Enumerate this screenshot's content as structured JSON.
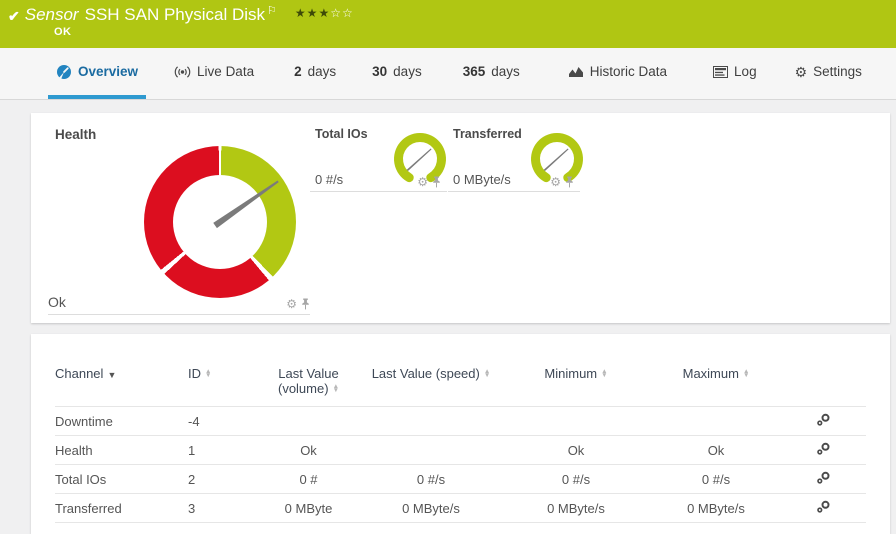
{
  "icons": {
    "check": "✔",
    "flag": "⚐",
    "stars_filled": "★★★",
    "stars_empty": "☆☆",
    "gear": "⚙",
    "sort_desc": "▼",
    "sort_up": "▲",
    "sort_down": "▼"
  },
  "header": {
    "kind": "Sensor",
    "title": "SSH SAN Physical Disk",
    "status": "OK"
  },
  "tabs": [
    {
      "label": "Overview",
      "icon": "gauge-icon",
      "active": true
    },
    {
      "label": "Live Data",
      "icon": "broadcast-icon"
    },
    {
      "num": "2",
      "label": "days"
    },
    {
      "num": "30",
      "label": "days"
    },
    {
      "num": "365",
      "label": "days"
    },
    {
      "label": "Historic Data",
      "icon": "area-chart-icon"
    },
    {
      "label": "Log",
      "icon": "log-icon"
    },
    {
      "label": "Settings",
      "icon": "gear-icon"
    }
  ],
  "gauges": {
    "health": {
      "label": "Health",
      "status": "Ok",
      "needle_deg": 55,
      "segments": [
        {
          "color": "#b2c813",
          "from_deg": 1,
          "to_deg": 136
        },
        {
          "color": "#dc0e1f",
          "from_deg": 140,
          "to_deg": 227
        },
        {
          "color": "#dc0e1f",
          "from_deg": 231,
          "to_deg": 359
        }
      ]
    },
    "total_ios": {
      "label": "Total IOs",
      "value": "0 #/s",
      "needle_deg": 48
    },
    "transferred": {
      "label": "Transferred",
      "value": "0 MByte/s",
      "needle_deg": 48
    }
  },
  "colors": {
    "header_green": "#b0c613",
    "gauge_green": "#b2c813",
    "gauge_red": "#dc0e1f",
    "active_tab_blue": "#2f9ad0"
  },
  "table": {
    "headers": {
      "channel": "Channel",
      "id": "ID",
      "volume": "Last Value (volume)",
      "speed": "Last Value (speed)",
      "min": "Minimum",
      "max": "Maximum"
    },
    "rows": [
      {
        "channel": "Downtime",
        "id": "-4",
        "volume": "",
        "speed": "",
        "min": "",
        "max": ""
      },
      {
        "channel": "Health",
        "id": "1",
        "volume": "Ok",
        "speed": "",
        "min": "Ok",
        "max": "Ok"
      },
      {
        "channel": "Total IOs",
        "id": "2",
        "volume": "0 #",
        "speed": "0 #/s",
        "min": "0 #/s",
        "max": "0 #/s"
      },
      {
        "channel": "Transferred",
        "id": "3",
        "volume": "0 MByte",
        "speed": "0 MByte/s",
        "min": "0 MByte/s",
        "max": "0 MByte/s"
      }
    ]
  }
}
